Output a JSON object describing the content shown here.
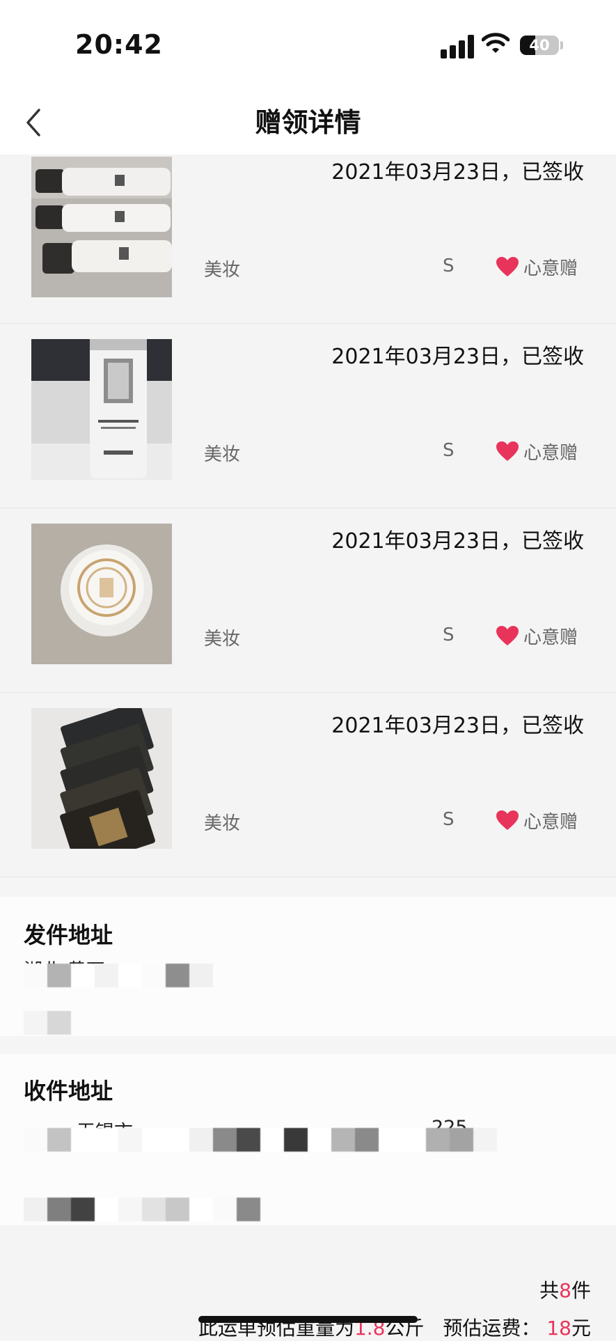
{
  "status_bar": {
    "time": "20:42",
    "battery": "40",
    "battery_level": 0.4
  },
  "nav": {
    "title": "赠领详情"
  },
  "items": [
    {
      "date": "2021年03月23日，已签收",
      "category": "美妆",
      "size": "S",
      "gift_type": "心意赠",
      "image": "three-cream-tubes-photo"
    },
    {
      "date": "2021年03月23日，已签收",
      "category": "美妆",
      "size": "S",
      "gift_type": "心意赠",
      "image": "makeup-lotion-bottle-photo"
    },
    {
      "date": "2021年03月23日，已签收",
      "category": "美妆",
      "size": "S",
      "gift_type": "心意赠",
      "image": "cream-jar-photo"
    },
    {
      "date": "2021年03月23日，已签收",
      "category": "美妆",
      "size": "S",
      "gift_type": "心意赠",
      "image": "sample-cards-photo"
    }
  ],
  "sender": {
    "title": "发件地址",
    "line1": "湖北 黄石"
  },
  "receiver": {
    "title": "收件地址",
    "line1": "无锡市",
    "line2": "225"
  },
  "footer": {
    "total_prefix": "共",
    "total_count": "8",
    "total_suffix": "件",
    "weight_prefix": "此运单预估重量为",
    "weight_value": "1.8",
    "weight_unit": "公斤",
    "fee_label": "预估运费：",
    "fee_value": "18",
    "fee_unit": "元"
  },
  "colors": {
    "accent": "#e8345a",
    "heart": "#e8345a"
  }
}
